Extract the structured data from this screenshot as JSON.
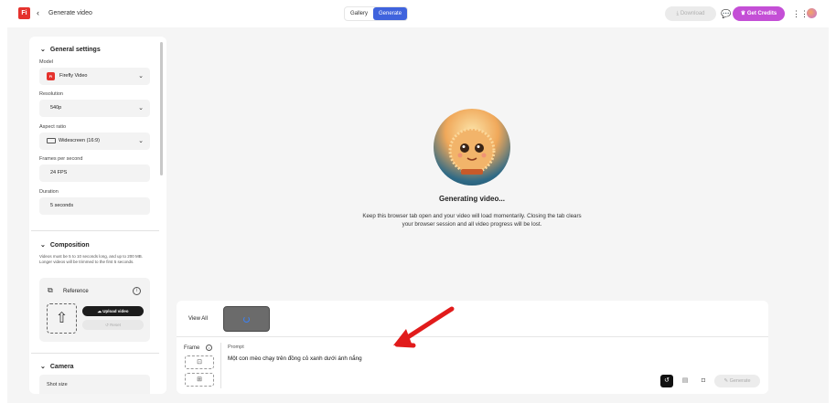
{
  "header": {
    "logo": "Fi",
    "back": "‹",
    "title": "Generate video",
    "tabs": [
      {
        "label": "Gallery"
      },
      {
        "label": "Generate"
      }
    ],
    "download_label": "Download",
    "credits_label": "Get Credits"
  },
  "sidebar": {
    "general_title": "General settings",
    "model_label": "Model",
    "model_value": "Firefly Video",
    "resolution_label": "Resolution",
    "resolution_value": "540p",
    "aspect_label": "Aspect ratio",
    "aspect_value": "Widescreen (16:9)",
    "fps_label": "Frames per second",
    "fps_value": "24 FPS",
    "duration_label": "Duration",
    "duration_value": "5 seconds",
    "composition_title": "Composition",
    "composition_note": "Videos must be 5 to 10 seconds long, and up to 200 MB. Longer videos will be trimmed to the first 5 seconds.",
    "reference_title": "Reference",
    "upload_label": "Upload video",
    "reset_label": "Reset",
    "camera_title": "Camera",
    "shot_size_label": "Shot size"
  },
  "main": {
    "status_title": "Generating video...",
    "status_desc": "Keep this browser tab open and your video will load momentarily. Closing the tab clears your browser session and all video progress will be lost."
  },
  "prompt": {
    "view_all": "View All",
    "frame_label": "Frame",
    "prompt_label": "Prompt",
    "prompt_text": "Một con mèo chạy trên đồng cỏ xanh dưới ánh nắng",
    "generate_label": "Generate"
  },
  "colors": {
    "accent_blue": "#3f63dd",
    "credits_purple": "#c44fd6",
    "brand_red": "#e5322d",
    "annotation_red": "#e11b1b"
  }
}
